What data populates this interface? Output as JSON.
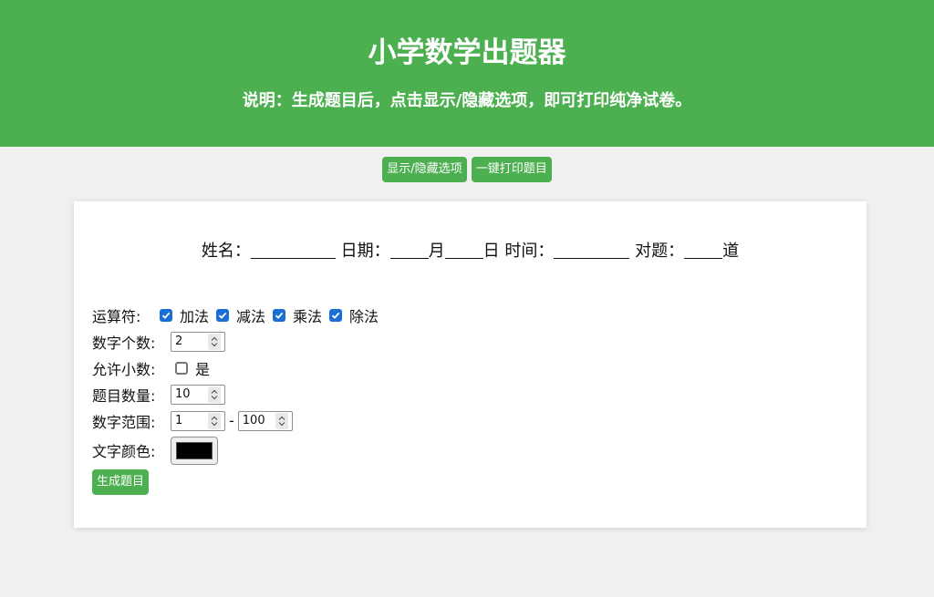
{
  "header": {
    "title": "小学数学出题器",
    "description": "说明：生成题目后，点击显示/隐藏选项，即可打印纯净试卷。"
  },
  "toolbar": {
    "toggle_label": "显示/隐藏选项",
    "print_label": "一键打印题目"
  },
  "info_line": {
    "name_label": "姓名：",
    "date_label": "日期：",
    "month_label": "月",
    "day_label": "日",
    "time_label": "时间：",
    "correct_label": "对题：",
    "correct_unit": "道"
  },
  "options": {
    "operator_label": "运算符:",
    "operators": [
      {
        "label": "加法",
        "checked": true
      },
      {
        "label": "减法",
        "checked": true
      },
      {
        "label": "乘法",
        "checked": true
      },
      {
        "label": "除法",
        "checked": true
      }
    ],
    "digit_count_label": "数字个数:",
    "digit_count_value": "2",
    "allow_decimal_label": "允许小数:",
    "allow_decimal_option": "是",
    "allow_decimal_checked": false,
    "question_count_label": "题目数量:",
    "question_count_value": "10",
    "range_label": "数字范围:",
    "range_min": "1",
    "range_separator": "-",
    "range_max": "100",
    "text_color_label": "文字颜色:",
    "text_color_value": "#000000",
    "generate_label": "生成题目"
  },
  "colors": {
    "accent": "#4caf50",
    "checkbox": "#1a6fd6",
    "background": "#f0f0f0"
  }
}
